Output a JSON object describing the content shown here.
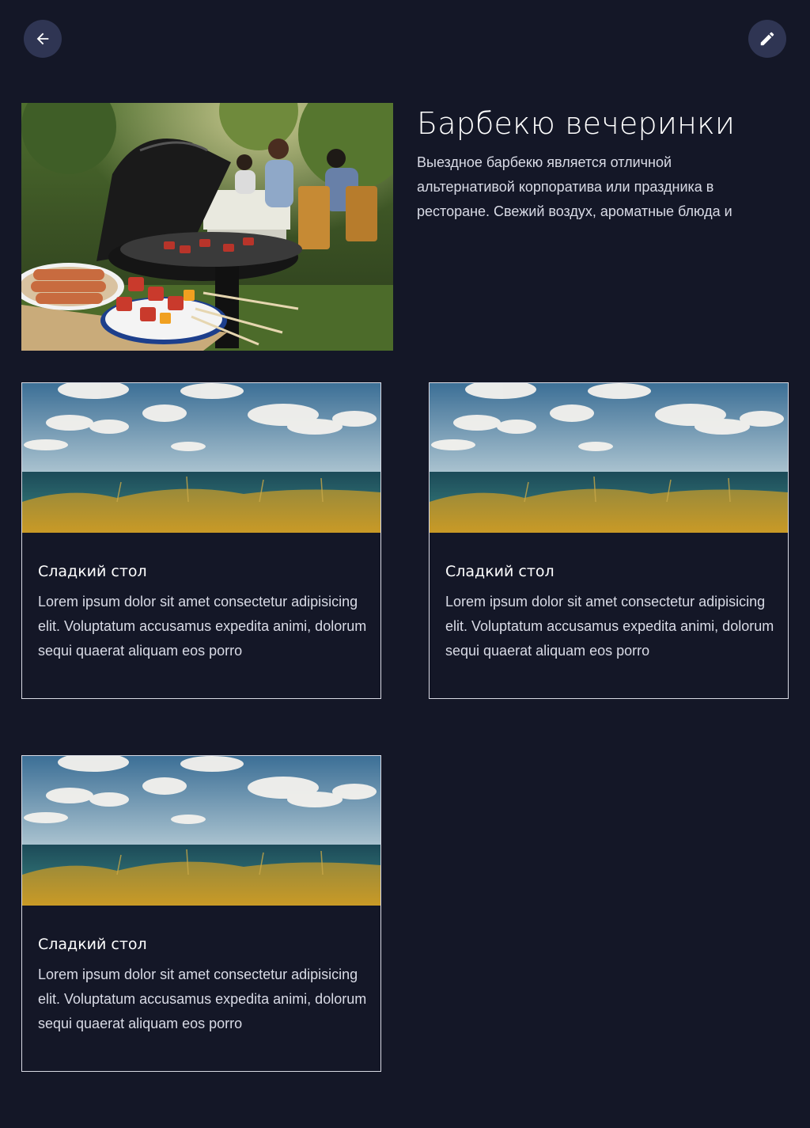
{
  "header": {
    "back_icon": "arrow-left-icon",
    "edit_icon": "pencil-icon"
  },
  "hero": {
    "title": "Барбекю вечеринки",
    "description": "Выездное барбекю является отличной альтернативой корпоратива или праздника в ресторане. Свежий воздух, ароматные блюда и",
    "image": "bbq-party-photo"
  },
  "cards": [
    {
      "title": "Сладкий стол",
      "text": "Lorem ipsum dolor sit amet consectetur adipisicing elit. Voluptatum accusamus expedita animi, dolorum sequi quaerat aliquam eos porro",
      "image": "seaside-landscape-photo"
    },
    {
      "title": "Сладкий стол",
      "text": "Lorem ipsum dolor sit amet consectetur adipisicing elit. Voluptatum accusamus expedita animi, dolorum sequi quaerat aliquam eos porro",
      "image": "seaside-landscape-photo"
    },
    {
      "title": "Сладкий стол",
      "text": "Lorem ipsum dolor sit amet consectetur adipisicing elit. Voluptatum accusamus expedita animi, dolorum sequi quaerat aliquam eos porro",
      "image": "seaside-landscape-photo"
    }
  ],
  "colors": {
    "background": "#141727",
    "button": "#2f3553",
    "card_border": "#d8dae4"
  }
}
